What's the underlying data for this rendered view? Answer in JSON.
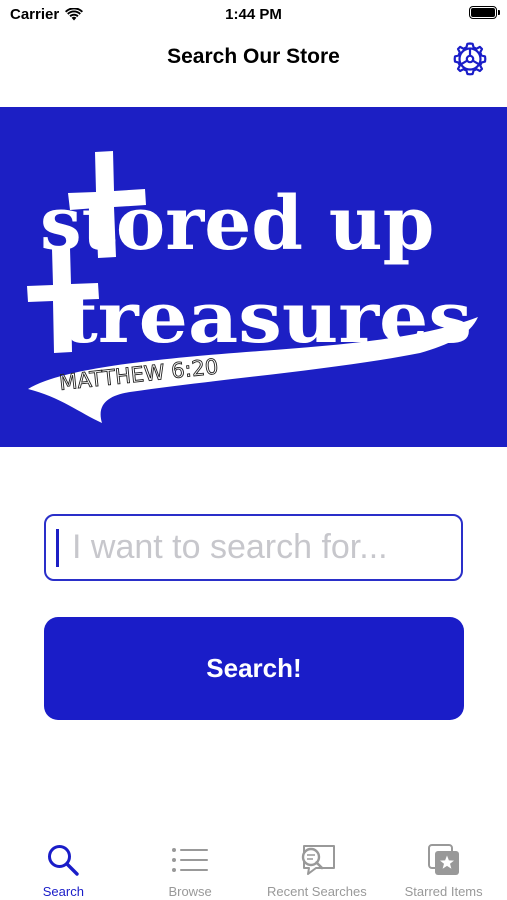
{
  "status_bar": {
    "carrier": "Carrier",
    "time": "1:44 PM"
  },
  "nav": {
    "title": "Search Our Store",
    "settings_icon": "gear-icon"
  },
  "banner": {
    "line1": "stored up",
    "line2": "treasures",
    "verse": "MATTHEW 6:20",
    "background": "#1c1fc4"
  },
  "search": {
    "placeholder": "I want to search for...",
    "value": "",
    "button_label": "Search!"
  },
  "tabs": [
    {
      "label": "Search",
      "icon": "magnifier-icon",
      "active": true
    },
    {
      "label": "Browse",
      "icon": "list-icon",
      "active": false
    },
    {
      "label": "Recent Searches",
      "icon": "recent-search-icon",
      "active": false
    },
    {
      "label": "Starred Items",
      "icon": "starred-items-icon",
      "active": false
    }
  ],
  "colors": {
    "accent": "#1a1dc8",
    "inactive_tab": "#999999",
    "placeholder": "#c7c7cc"
  }
}
